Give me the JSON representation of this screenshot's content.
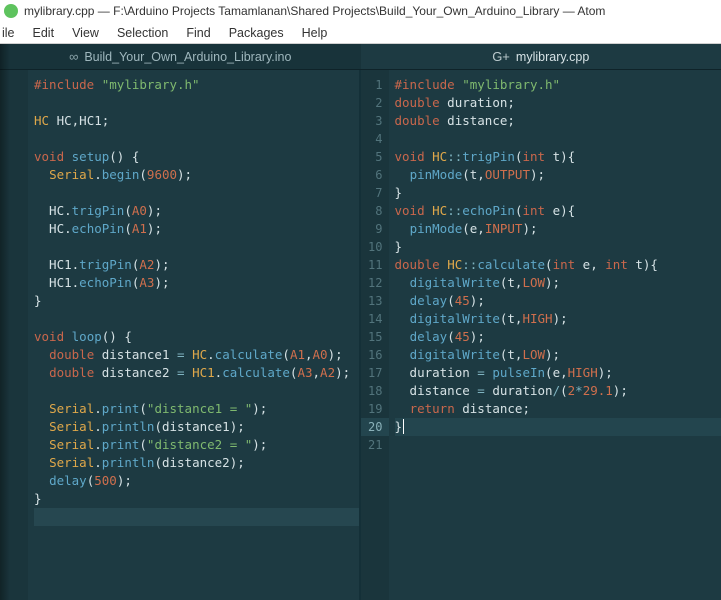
{
  "window": {
    "title": "mylibrary.cpp — F:\\Arduino Projects Tamamlanan\\Shared Projects\\Build_Your_Own_Arduino_Library — Atom"
  },
  "menu": {
    "file": "ile",
    "edit": "Edit",
    "view": "View",
    "selection": "Selection",
    "find": "Find",
    "packages": "Packages",
    "help": "Help"
  },
  "tabs": {
    "left": {
      "icon": "∞",
      "label": "Build_Your_Own_Arduino_Library.ino"
    },
    "right": {
      "icon": "G+",
      "label": "mylibrary.cpp"
    }
  },
  "leftPane": {
    "lines": [
      [
        {
          "c": "pp",
          "t": "#include"
        },
        {
          "c": "punc",
          "t": " "
        },
        {
          "c": "str",
          "t": "\"mylibrary.h\""
        }
      ],
      [],
      [
        {
          "c": "cls",
          "t": "HC"
        },
        {
          "c": "id",
          "t": " HC"
        },
        {
          "c": "punc",
          "t": ","
        },
        {
          "c": "id",
          "t": "HC1"
        },
        {
          "c": "punc",
          "t": ";"
        }
      ],
      [],
      [
        {
          "c": "kw",
          "t": "void"
        },
        {
          "c": "id",
          "t": " "
        },
        {
          "c": "fn",
          "t": "setup"
        },
        {
          "c": "punc",
          "t": "() {"
        }
      ],
      [
        {
          "c": "id",
          "t": "  "
        },
        {
          "c": "cls",
          "t": "Serial"
        },
        {
          "c": "punc",
          "t": "."
        },
        {
          "c": "fn",
          "t": "begin"
        },
        {
          "c": "punc",
          "t": "("
        },
        {
          "c": "num",
          "t": "9600"
        },
        {
          "c": "punc",
          "t": ");"
        }
      ],
      [],
      [
        {
          "c": "id",
          "t": "  HC."
        },
        {
          "c": "fn",
          "t": "trigPin"
        },
        {
          "c": "punc",
          "t": "("
        },
        {
          "c": "const",
          "t": "A0"
        },
        {
          "c": "punc",
          "t": ");"
        }
      ],
      [
        {
          "c": "id",
          "t": "  HC."
        },
        {
          "c": "fn",
          "t": "echoPin"
        },
        {
          "c": "punc",
          "t": "("
        },
        {
          "c": "const",
          "t": "A1"
        },
        {
          "c": "punc",
          "t": ");"
        }
      ],
      [],
      [
        {
          "c": "id",
          "t": "  HC1."
        },
        {
          "c": "fn",
          "t": "trigPin"
        },
        {
          "c": "punc",
          "t": "("
        },
        {
          "c": "const",
          "t": "A2"
        },
        {
          "c": "punc",
          "t": ");"
        }
      ],
      [
        {
          "c": "id",
          "t": "  HC1."
        },
        {
          "c": "fn",
          "t": "echoPin"
        },
        {
          "c": "punc",
          "t": "("
        },
        {
          "c": "const",
          "t": "A3"
        },
        {
          "c": "punc",
          "t": ");"
        }
      ],
      [
        {
          "c": "punc",
          "t": "}"
        }
      ],
      [],
      [
        {
          "c": "kw",
          "t": "void"
        },
        {
          "c": "id",
          "t": " "
        },
        {
          "c": "fn",
          "t": "loop"
        },
        {
          "c": "punc",
          "t": "() {"
        }
      ],
      [
        {
          "c": "id",
          "t": "  "
        },
        {
          "c": "kw",
          "t": "double"
        },
        {
          "c": "id",
          "t": " distance1 "
        },
        {
          "c": "op",
          "t": "="
        },
        {
          "c": "id",
          "t": " "
        },
        {
          "c": "cls",
          "t": "HC"
        },
        {
          "c": "punc",
          "t": "."
        },
        {
          "c": "fn",
          "t": "calculate"
        },
        {
          "c": "punc",
          "t": "("
        },
        {
          "c": "const",
          "t": "A1"
        },
        {
          "c": "punc",
          "t": ","
        },
        {
          "c": "const",
          "t": "A0"
        },
        {
          "c": "punc",
          "t": ");"
        }
      ],
      [
        {
          "c": "id",
          "t": "  "
        },
        {
          "c": "kw",
          "t": "double"
        },
        {
          "c": "id",
          "t": " distance2 "
        },
        {
          "c": "op",
          "t": "="
        },
        {
          "c": "id",
          "t": " "
        },
        {
          "c": "cls",
          "t": "HC1"
        },
        {
          "c": "punc",
          "t": "."
        },
        {
          "c": "fn",
          "t": "calculate"
        },
        {
          "c": "punc",
          "t": "("
        },
        {
          "c": "const",
          "t": "A3"
        },
        {
          "c": "punc",
          "t": ","
        },
        {
          "c": "const",
          "t": "A2"
        },
        {
          "c": "punc",
          "t": ");"
        }
      ],
      [],
      [
        {
          "c": "id",
          "t": "  "
        },
        {
          "c": "cls",
          "t": "Serial"
        },
        {
          "c": "punc",
          "t": "."
        },
        {
          "c": "fn",
          "t": "print"
        },
        {
          "c": "punc",
          "t": "("
        },
        {
          "c": "str",
          "t": "\"distance1 = \""
        },
        {
          "c": "punc",
          "t": ");"
        }
      ],
      [
        {
          "c": "id",
          "t": "  "
        },
        {
          "c": "cls",
          "t": "Serial"
        },
        {
          "c": "punc",
          "t": "."
        },
        {
          "c": "fn",
          "t": "println"
        },
        {
          "c": "punc",
          "t": "(distance1);"
        }
      ],
      [
        {
          "c": "id",
          "t": "  "
        },
        {
          "c": "cls",
          "t": "Serial"
        },
        {
          "c": "punc",
          "t": "."
        },
        {
          "c": "fn",
          "t": "print"
        },
        {
          "c": "punc",
          "t": "("
        },
        {
          "c": "str",
          "t": "\"distance2 = \""
        },
        {
          "c": "punc",
          "t": ");"
        }
      ],
      [
        {
          "c": "id",
          "t": "  "
        },
        {
          "c": "cls",
          "t": "Serial"
        },
        {
          "c": "punc",
          "t": "."
        },
        {
          "c": "fn",
          "t": "println"
        },
        {
          "c": "punc",
          "t": "(distance2);"
        }
      ],
      [
        {
          "c": "id",
          "t": "  "
        },
        {
          "c": "fn",
          "t": "delay"
        },
        {
          "c": "punc",
          "t": "("
        },
        {
          "c": "num",
          "t": "500"
        },
        {
          "c": "punc",
          "t": ");"
        }
      ],
      [
        {
          "c": "punc",
          "t": "}"
        }
      ],
      []
    ],
    "selectedRange": [
      24,
      24
    ]
  },
  "rightPane": {
    "startLine": 1,
    "highlightLine": 20,
    "lines": [
      [
        {
          "c": "pp",
          "t": "#include"
        },
        {
          "c": "punc",
          "t": " "
        },
        {
          "c": "str",
          "t": "\"mylibrary.h\""
        }
      ],
      [
        {
          "c": "kw",
          "t": "double"
        },
        {
          "c": "id",
          "t": " duration;"
        }
      ],
      [
        {
          "c": "kw",
          "t": "double"
        },
        {
          "c": "id",
          "t": " distance;"
        }
      ],
      [],
      [
        {
          "c": "kw",
          "t": "void"
        },
        {
          "c": "id",
          "t": " "
        },
        {
          "c": "cls",
          "t": "HC"
        },
        {
          "c": "op",
          "t": "::"
        },
        {
          "c": "fn",
          "t": "trigPin"
        },
        {
          "c": "punc",
          "t": "("
        },
        {
          "c": "kw",
          "t": "int"
        },
        {
          "c": "id",
          "t": " t"
        },
        {
          "c": "punc",
          "t": "){"
        }
      ],
      [
        {
          "c": "id",
          "t": "  "
        },
        {
          "c": "fn",
          "t": "pinMode"
        },
        {
          "c": "punc",
          "t": "(t,"
        },
        {
          "c": "const",
          "t": "OUTPUT"
        },
        {
          "c": "punc",
          "t": ");"
        }
      ],
      [
        {
          "c": "punc",
          "t": "}"
        }
      ],
      [
        {
          "c": "kw",
          "t": "void"
        },
        {
          "c": "id",
          "t": " "
        },
        {
          "c": "cls",
          "t": "HC"
        },
        {
          "c": "op",
          "t": "::"
        },
        {
          "c": "fn",
          "t": "echoPin"
        },
        {
          "c": "punc",
          "t": "("
        },
        {
          "c": "kw",
          "t": "int"
        },
        {
          "c": "id",
          "t": " e"
        },
        {
          "c": "punc",
          "t": "){"
        }
      ],
      [
        {
          "c": "id",
          "t": "  "
        },
        {
          "c": "fn",
          "t": "pinMode"
        },
        {
          "c": "punc",
          "t": "(e,"
        },
        {
          "c": "const",
          "t": "INPUT"
        },
        {
          "c": "punc",
          "t": ");"
        }
      ],
      [
        {
          "c": "punc",
          "t": "}"
        }
      ],
      [
        {
          "c": "kw",
          "t": "double"
        },
        {
          "c": "id",
          "t": " "
        },
        {
          "c": "cls",
          "t": "HC"
        },
        {
          "c": "op",
          "t": "::"
        },
        {
          "c": "fn",
          "t": "calculate"
        },
        {
          "c": "punc",
          "t": "("
        },
        {
          "c": "kw",
          "t": "int"
        },
        {
          "c": "id",
          "t": " e, "
        },
        {
          "c": "kw",
          "t": "int"
        },
        {
          "c": "id",
          "t": " t"
        },
        {
          "c": "punc",
          "t": "){"
        }
      ],
      [
        {
          "c": "id",
          "t": "  "
        },
        {
          "c": "fn",
          "t": "digitalWrite"
        },
        {
          "c": "punc",
          "t": "(t,"
        },
        {
          "c": "const",
          "t": "LOW"
        },
        {
          "c": "punc",
          "t": ");"
        }
      ],
      [
        {
          "c": "id",
          "t": "  "
        },
        {
          "c": "fn",
          "t": "delay"
        },
        {
          "c": "punc",
          "t": "("
        },
        {
          "c": "num",
          "t": "45"
        },
        {
          "c": "punc",
          "t": ");"
        }
      ],
      [
        {
          "c": "id",
          "t": "  "
        },
        {
          "c": "fn",
          "t": "digitalWrite"
        },
        {
          "c": "punc",
          "t": "(t,"
        },
        {
          "c": "const",
          "t": "HIGH"
        },
        {
          "c": "punc",
          "t": ");"
        }
      ],
      [
        {
          "c": "id",
          "t": "  "
        },
        {
          "c": "fn",
          "t": "delay"
        },
        {
          "c": "punc",
          "t": "("
        },
        {
          "c": "num",
          "t": "45"
        },
        {
          "c": "punc",
          "t": ");"
        }
      ],
      [
        {
          "c": "id",
          "t": "  "
        },
        {
          "c": "fn",
          "t": "digitalWrite"
        },
        {
          "c": "punc",
          "t": "(t,"
        },
        {
          "c": "const",
          "t": "LOW"
        },
        {
          "c": "punc",
          "t": ");"
        }
      ],
      [
        {
          "c": "id",
          "t": "  duration "
        },
        {
          "c": "op",
          "t": "="
        },
        {
          "c": "id",
          "t": " "
        },
        {
          "c": "fn",
          "t": "pulseIn"
        },
        {
          "c": "punc",
          "t": "(e,"
        },
        {
          "c": "const",
          "t": "HIGH"
        },
        {
          "c": "punc",
          "t": ");"
        }
      ],
      [
        {
          "c": "id",
          "t": "  distance "
        },
        {
          "c": "op",
          "t": "="
        },
        {
          "c": "id",
          "t": " duration"
        },
        {
          "c": "op",
          "t": "/"
        },
        {
          "c": "punc",
          "t": "("
        },
        {
          "c": "num",
          "t": "2"
        },
        {
          "c": "op",
          "t": "*"
        },
        {
          "c": "num",
          "t": "29.1"
        },
        {
          "c": "punc",
          "t": ");"
        }
      ],
      [
        {
          "c": "id",
          "t": "  "
        },
        {
          "c": "kw",
          "t": "return"
        },
        {
          "c": "id",
          "t": " distance;"
        }
      ],
      [
        {
          "c": "punc",
          "t": "}"
        },
        {
          "c": "cursor",
          "t": ""
        }
      ],
      []
    ]
  }
}
